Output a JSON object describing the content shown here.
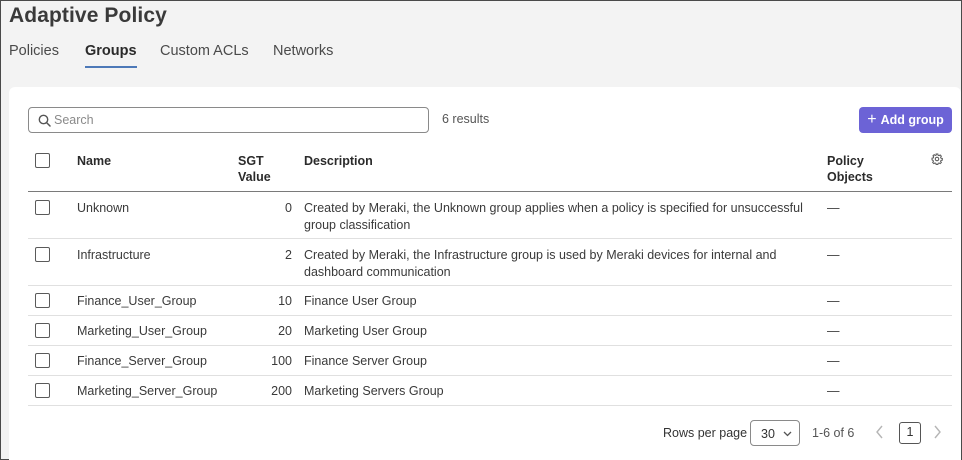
{
  "page": {
    "title": "Adaptive Policy"
  },
  "tabs": [
    {
      "label": "Policies",
      "active": false
    },
    {
      "label": "Groups",
      "active": true
    },
    {
      "label": "Custom ACLs",
      "active": false
    },
    {
      "label": "Networks",
      "active": false
    }
  ],
  "toolbar": {
    "search_placeholder": "Search",
    "results": "6 results",
    "add_label": "Add group",
    "add_icon": "plus-icon",
    "accent": "#6c63d6"
  },
  "table": {
    "headers": {
      "name": "Name",
      "sgt_line1": "SGT",
      "sgt_line2": "Value",
      "description": "Description",
      "policy_line1": "Policy",
      "policy_line2": "Objects"
    },
    "settings_icon": "gear-icon",
    "rows": [
      {
        "name": "Unknown",
        "sgt": "0",
        "desc1": "Created by Meraki, the Unknown group applies when a policy is specified for unsuccessful",
        "desc2": "group classification",
        "policy": "—"
      },
      {
        "name": "Infrastructure",
        "sgt": "2",
        "desc1": "Created by Meraki, the Infrastructure group is used by Meraki devices for internal and",
        "desc2": "dashboard communication",
        "policy": "—"
      },
      {
        "name": "Finance_User_Group",
        "sgt": "10",
        "desc1": "Finance User Group",
        "desc2": "",
        "policy": "—"
      },
      {
        "name": "Marketing_User_Group",
        "sgt": "20",
        "desc1": "Marketing User Group",
        "desc2": "",
        "policy": "—"
      },
      {
        "name": "Finance_Server_Group",
        "sgt": "100",
        "desc1": "Finance Server Group",
        "desc2": "",
        "policy": "—"
      },
      {
        "name": "Marketing_Server_Group",
        "sgt": "200",
        "desc1": "Marketing Servers Group",
        "desc2": "",
        "policy": "—"
      }
    ]
  },
  "pagination": {
    "rows_per_page_label": "Rows per page",
    "rows_per_page_value": "30",
    "range": "1-6 of 6",
    "current_page": "1"
  }
}
